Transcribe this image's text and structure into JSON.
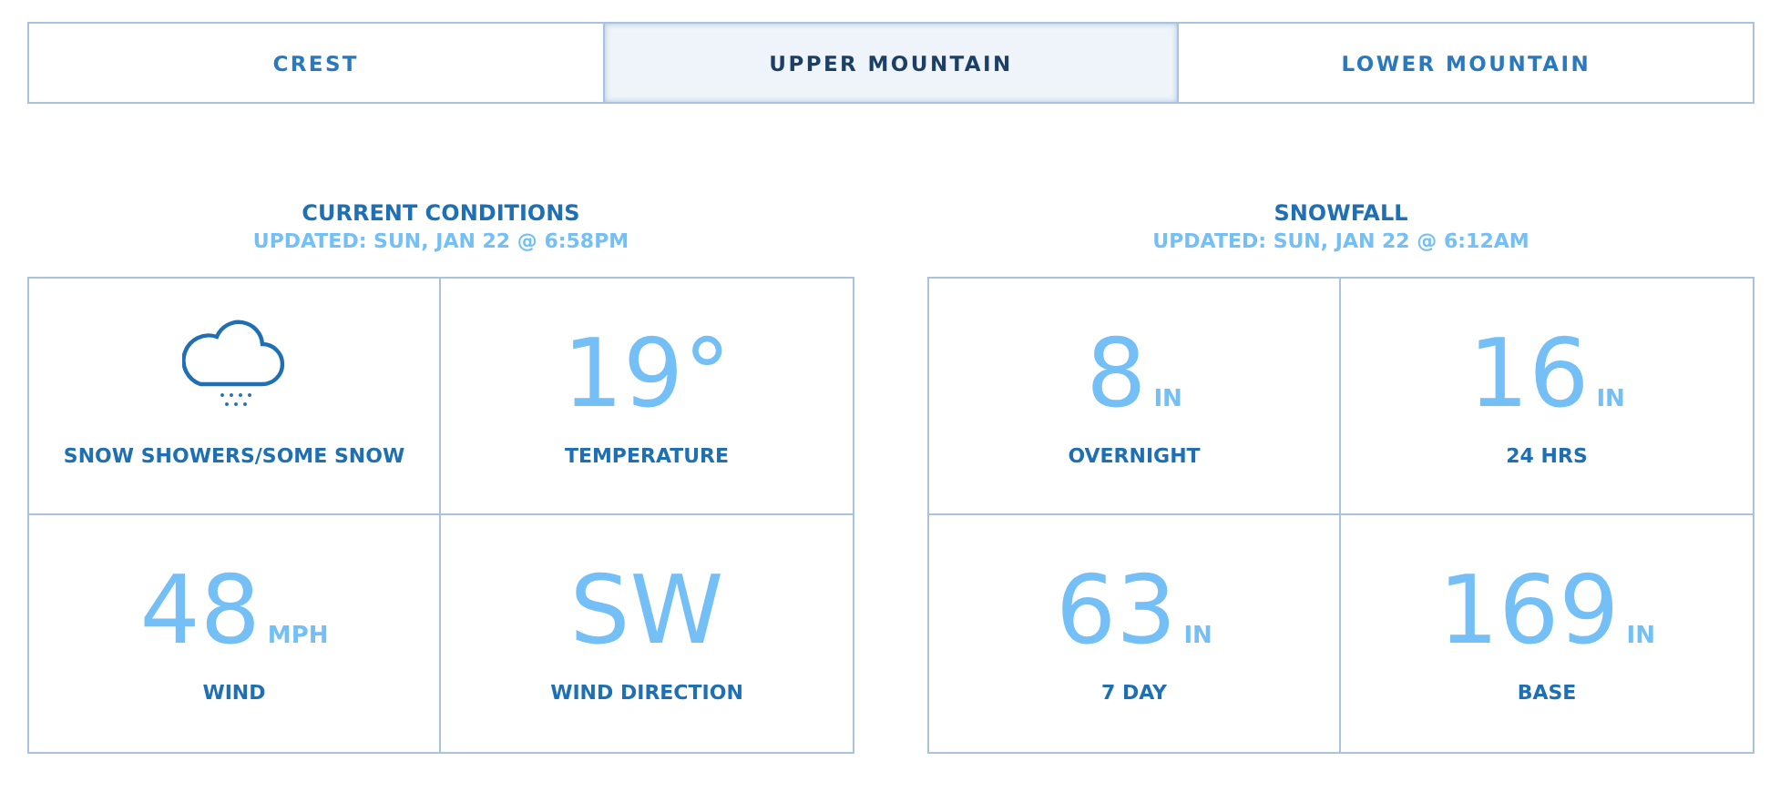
{
  "tabs": [
    {
      "label": "CREST",
      "selected": false
    },
    {
      "label": "UPPER MOUNTAIN",
      "selected": true
    },
    {
      "label": "LOWER MOUNTAIN",
      "selected": false
    }
  ],
  "sections": [
    {
      "title": "CURRENT CONDITIONS",
      "updated": "UPDATED: SUN, JAN 22 @ 6:58PM",
      "sky": {
        "label": "SNOW SHOWERS/SOME SNOW"
      },
      "cells": [
        {
          "value": "19°",
          "label": "TEMPERATURE"
        },
        {
          "value": "48",
          "unit": "MPH",
          "label": "WIND"
        },
        {
          "value": "SW",
          "label": "WIND DIRECTION"
        }
      ]
    },
    {
      "title": "SNOWFALL",
      "updated": "UPDATED: SUN, JAN 22 @ 6:12AM",
      "cells": [
        {
          "value": "8",
          "unit": "IN",
          "label": "OVERNIGHT"
        },
        {
          "value": "16",
          "unit": "IN",
          "label": "24 HRS"
        },
        {
          "value": "63",
          "unit": "IN",
          "label": "7 DAY"
        },
        {
          "value": "169",
          "unit": "IN",
          "label": "BASE"
        }
      ]
    }
  ]
}
